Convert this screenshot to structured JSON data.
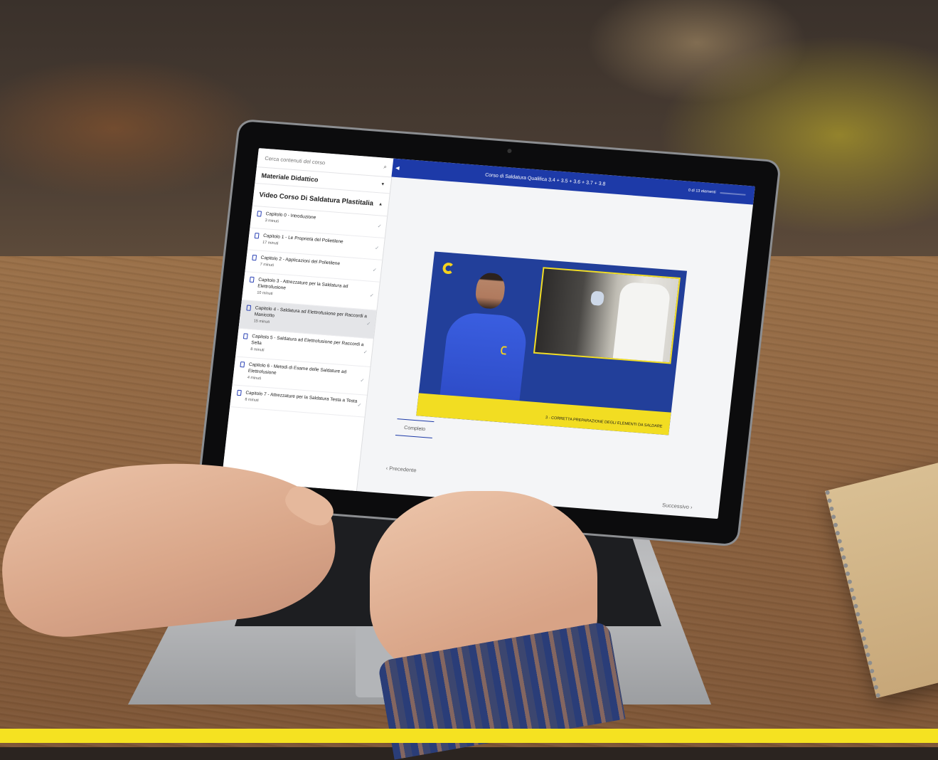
{
  "sidebar": {
    "search_placeholder": "Cerca contenuti del corso",
    "sections": [
      {
        "title": "Materiale Didattico"
      },
      {
        "title": "Video Corso Di Saldatura Plastitalia"
      }
    ],
    "lessons": [
      {
        "title": "Capitolo 0 - Introduzione",
        "duration": "3 minuti",
        "completed": true,
        "active": false
      },
      {
        "title": "Capitolo 1 - Le Proprietà del Polietilene",
        "duration": "17 minuti",
        "completed": true,
        "active": false
      },
      {
        "title": "Capitolo 2 - Applicazioni del Polietilene",
        "duration": "7 minuti",
        "completed": true,
        "active": false
      },
      {
        "title": "Capitolo 3 - Attrezzature per la Saldatura ad Elettrofusione",
        "duration": "10 minuti",
        "completed": true,
        "active": false
      },
      {
        "title": "Capitolo 4 - Saldatura ad Elettrofusione per Raccordi a Manicotto",
        "duration": "15 minuti",
        "completed": true,
        "active": true
      },
      {
        "title": "Capitolo 5 - Saldatura ad Elettrofusione per Raccordi a Sella",
        "duration": "8 minuti",
        "completed": true,
        "active": false
      },
      {
        "title": "Capitolo 6 - Metodi di Esame delle Saldature ad Elettrofusione",
        "duration": "4 minuti",
        "completed": true,
        "active": false
      },
      {
        "title": "Capitolo 7 - Attrezzature per la Saldatura Testa a Testa",
        "duration": "8 minuti",
        "completed": true,
        "active": false
      }
    ]
  },
  "header": {
    "course_title": "Corso di Saldatura Qualifica 3.4 + 3.5 + 3.6 + 3.7 + 3.8",
    "progress_label": "0 di 13 elementi",
    "progress_fraction": 0.0,
    "accent_color": "#1d3aa8"
  },
  "video": {
    "caption": "3 - CORRETTA PREPARAZIONE DEGLI ELEMENTI DA SALDARE",
    "brand_color": "#f2dd22"
  },
  "footer": {
    "complete_label": "Completo",
    "prev_label": "‹ Precedente",
    "next_label": "Successivo ›"
  },
  "icons": {
    "search": "search-icon",
    "check": "check-icon",
    "document": "document-icon",
    "collapse": "collapse-sidebar-icon"
  }
}
